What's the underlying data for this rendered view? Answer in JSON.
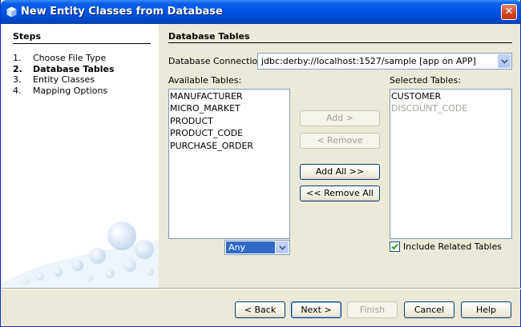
{
  "window": {
    "title": "New Entity Classes from Database",
    "close_glyph": "✕"
  },
  "steps": {
    "title": "Steps",
    "items": [
      {
        "num": "1.",
        "label": "Choose File Type"
      },
      {
        "num": "2.",
        "label": "Database Tables"
      },
      {
        "num": "3.",
        "label": "Entity Classes"
      },
      {
        "num": "4.",
        "label": "Mapping Options"
      }
    ],
    "current_index": 1
  },
  "panel": {
    "title": "Database Tables",
    "connection_label": "Database Connection:",
    "connection_value": "jdbc:derby://localhost:1527/sample [app on APP]",
    "available_label": "Available Tables:",
    "available_tables": [
      "MANUFACTURER",
      "MICRO_MARKET",
      "PRODUCT",
      "PRODUCT_CODE",
      "PURCHASE_ORDER"
    ],
    "filter_value": "Any",
    "selected_label": "Selected Tables:",
    "selected_tables": [
      {
        "name": "CUSTOMER",
        "enabled": true
      },
      {
        "name": "DISCOUNT_CODE",
        "enabled": false
      }
    ],
    "include_related_label": "Include Related Tables",
    "include_related_checked": true
  },
  "transfer_buttons": {
    "add": "Add >",
    "remove": "< Remove",
    "add_all": "Add All >>",
    "remove_all": "<< Remove All"
  },
  "footer": {
    "back": "< Back",
    "next": "Next >",
    "finish": "Finish",
    "cancel": "Cancel",
    "help": "Help"
  },
  "colors": {
    "title_bar": "#0054e3",
    "dialog_bg": "#ece9d8",
    "selection": "#316ac5",
    "disabled_text": "#a19f97"
  }
}
